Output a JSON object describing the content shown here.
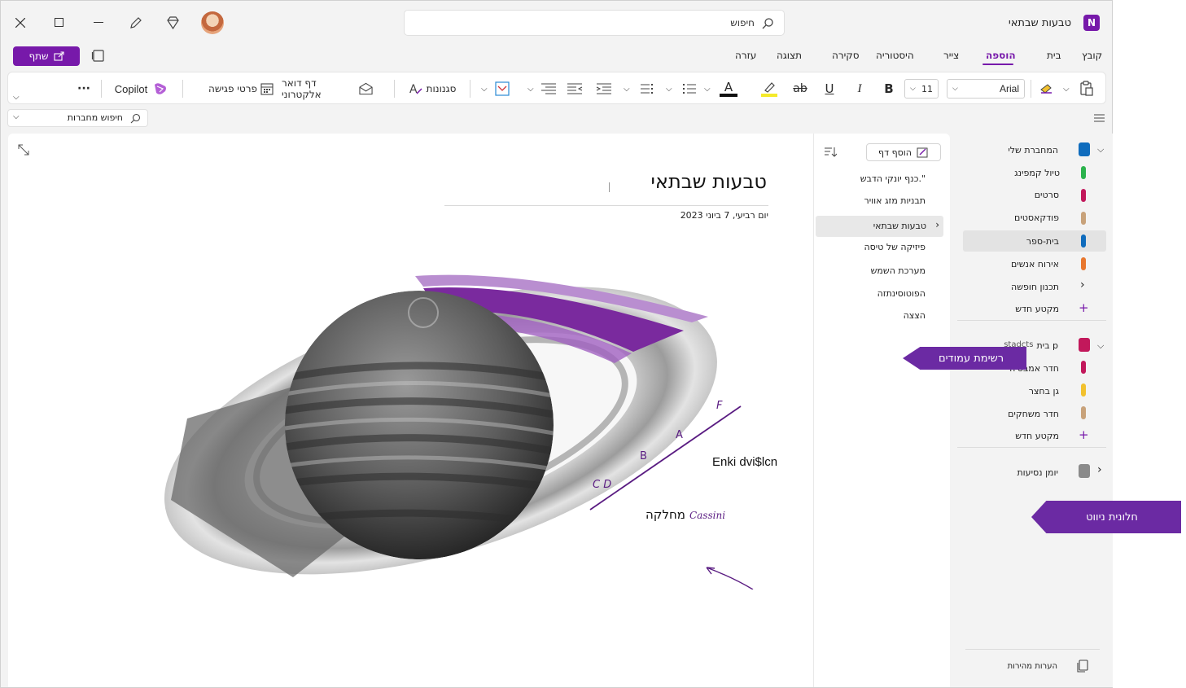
{
  "window": {
    "title": "טבעות שבתאי",
    "search_placeholder": "חיפוש",
    "share_label": "שתף"
  },
  "menu_tabs": [
    {
      "label": "קובץ"
    },
    {
      "label": "בית"
    },
    {
      "label": "הוספה"
    },
    {
      "label": "צייר"
    },
    {
      "label": "היסטוריה"
    },
    {
      "label": "סקירה"
    },
    {
      "label": "תצוגה"
    },
    {
      "label": "עזרה"
    }
  ],
  "ribbon": {
    "font_name": "Arial",
    "font_size": "11",
    "bold": "B",
    "italic": "I",
    "underline": "U",
    "strike": "ab",
    "font_color": "A",
    "styles_label": "סגנונות",
    "email_page_label": "דף דואר אלקטרוני",
    "meeting_details_label": "פרטי פגישה",
    "copilot_label": "Copilot",
    "more": "···"
  },
  "search_notebooks": {
    "placeholder": "חיפוש מחברות"
  },
  "page": {
    "title": "טבעות שבתאי",
    "date": "יום רביעי, 7 ביוני 2023",
    "labels": {
      "ring_f": "F",
      "ring_a": "A",
      "ring_b": "B",
      "ring_cd": "C D",
      "encke": "Enki dvi$lcn",
      "cassini_script": "Cassini",
      "cassini_heb": "מחלקה"
    }
  },
  "page_list": {
    "add_page": "הוסף דף",
    "items": [
      {
        "label": "כנף יונקי הדבש.\""
      },
      {
        "label": "תבניות מזג אוויר"
      },
      {
        "label": "טבעות שבתאי"
      },
      {
        "label": "פיזיקה של טיסה"
      },
      {
        "label": "מערכת השמש"
      },
      {
        "label": "הפוטוסינתזה"
      },
      {
        "label": "הצצה"
      }
    ]
  },
  "navigation": {
    "notebooks": [
      {
        "name": "המחברת שלי",
        "color": "#0f6cbd",
        "sections": [
          {
            "label": "טיול קמפינג",
            "color": "#2bb24c"
          },
          {
            "label": "סרטים",
            "color": "#c2185b"
          },
          {
            "label": "פודקאסטים",
            "color": "#c8a27a"
          },
          {
            "label": "בית-ספר",
            "color": "#0f6cbd"
          },
          {
            "label": "אירוח אנשים",
            "color": "#e8772e"
          },
          {
            "label": "תכנון חופשה",
            "color": ""
          }
        ],
        "new_section": "מקטע חדש"
      },
      {
        "name": "בית p",
        "name_extra": "stadcts",
        "color": "#c2185b",
        "sections": [
          {
            "label": "חדר אמבטיה",
            "color": "#c2185b"
          },
          {
            "label": "גן בחצר",
            "color": "#f2c12e"
          },
          {
            "label": "חדר משחקים",
            "color": "#c8a27a"
          }
        ],
        "new_section": "מקטע חדש"
      },
      {
        "name": "יומן נסיעות",
        "color": "#8a8a8a"
      }
    ],
    "quick_notes": "הערות מהירות"
  },
  "callouts": {
    "page_list": "רשימת עמודים",
    "nav_pane": "חלונית ניווט"
  },
  "colors": {
    "accent": "#7719aa",
    "callout": "#6b2aa3",
    "ring_purple": "#7a2a9e"
  }
}
